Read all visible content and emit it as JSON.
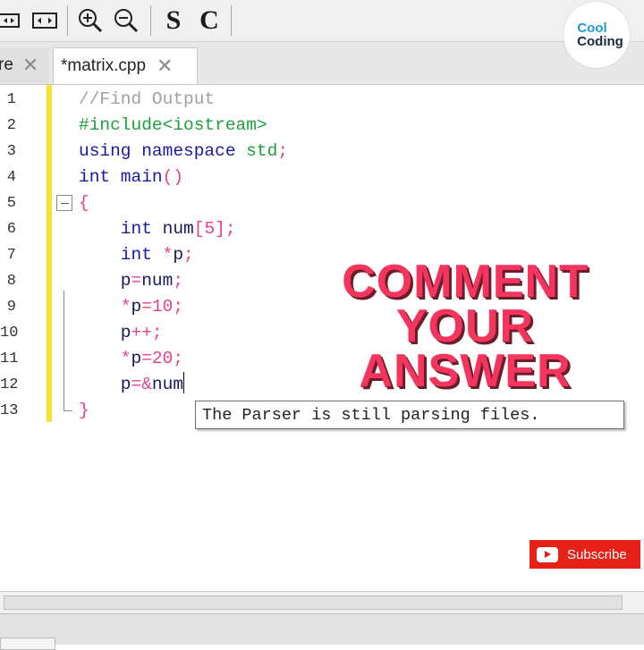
{
  "toolbar": {
    "icons": [
      "rectangle-select-icon",
      "rectangle-select-icon",
      "zoom-in-icon",
      "zoom-out-icon"
    ],
    "s_label": "S",
    "c_label": "C"
  },
  "logo": {
    "line1": "Cool",
    "line2": "Coding"
  },
  "tabs": [
    {
      "label": "re",
      "active": false
    },
    {
      "label": "*matrix.cpp",
      "active": true
    }
  ],
  "tab_close_glyph": "✕",
  "editor": {
    "line_numbers": [
      "1",
      "2",
      "3",
      "4",
      "5",
      "6",
      "7",
      "8",
      "9",
      "10",
      "11",
      "12",
      "13"
    ],
    "lines": [
      [
        {
          "t": "//Find Output",
          "c": "c-comment"
        }
      ],
      [
        {
          "t": "#include<iostream>",
          "c": "c-pre"
        }
      ],
      [
        {
          "t": "using namespace ",
          "c": "c-kw"
        },
        {
          "t": "std",
          "c": "c-std"
        },
        {
          "t": ";",
          "c": "c-punct"
        }
      ],
      [
        {
          "t": "int main",
          "c": "c-kw"
        },
        {
          "t": "()",
          "c": "c-punct"
        }
      ],
      [
        {
          "t": "{",
          "c": "c-punct"
        }
      ],
      [
        {
          "t": "    int ",
          "c": "c-kw"
        },
        {
          "t": "num",
          "c": "c-plain"
        },
        {
          "t": "[",
          "c": "c-punct"
        },
        {
          "t": "5",
          "c": "c-num"
        },
        {
          "t": "];",
          "c": "c-punct"
        }
      ],
      [
        {
          "t": "    int ",
          "c": "c-kw"
        },
        {
          "t": "*",
          "c": "c-punct"
        },
        {
          "t": "p",
          "c": "c-plain"
        },
        {
          "t": ";",
          "c": "c-punct"
        }
      ],
      [
        {
          "t": "    p",
          "c": "c-plain"
        },
        {
          "t": "=",
          "c": "c-punct"
        },
        {
          "t": "num",
          "c": "c-plain"
        },
        {
          "t": ";",
          "c": "c-punct"
        }
      ],
      [
        {
          "t": "    *",
          "c": "c-punct"
        },
        {
          "t": "p",
          "c": "c-plain"
        },
        {
          "t": "=",
          "c": "c-punct"
        },
        {
          "t": "10",
          "c": "c-num"
        },
        {
          "t": ";",
          "c": "c-punct"
        }
      ],
      [
        {
          "t": "    p",
          "c": "c-plain"
        },
        {
          "t": "++;",
          "c": "c-punct"
        }
      ],
      [
        {
          "t": "    *",
          "c": "c-punct"
        },
        {
          "t": "p",
          "c": "c-plain"
        },
        {
          "t": "=",
          "c": "c-punct"
        },
        {
          "t": "20",
          "c": "c-num"
        },
        {
          "t": ";",
          "c": "c-punct"
        }
      ],
      [
        {
          "t": "    p",
          "c": "c-plain"
        },
        {
          "t": "=",
          "c": "c-punct"
        },
        {
          "t": "&",
          "c": "c-punct"
        },
        {
          "t": "num",
          "c": "c-plain"
        }
      ],
      [
        {
          "t": "}",
          "c": "c-punct"
        }
      ]
    ],
    "caret_line": 12
  },
  "tooltip": "The Parser is still parsing files.",
  "overlay": {
    "words": [
      "Comment",
      "Your",
      "Answer"
    ]
  },
  "subscribe_label": "Subscribe"
}
